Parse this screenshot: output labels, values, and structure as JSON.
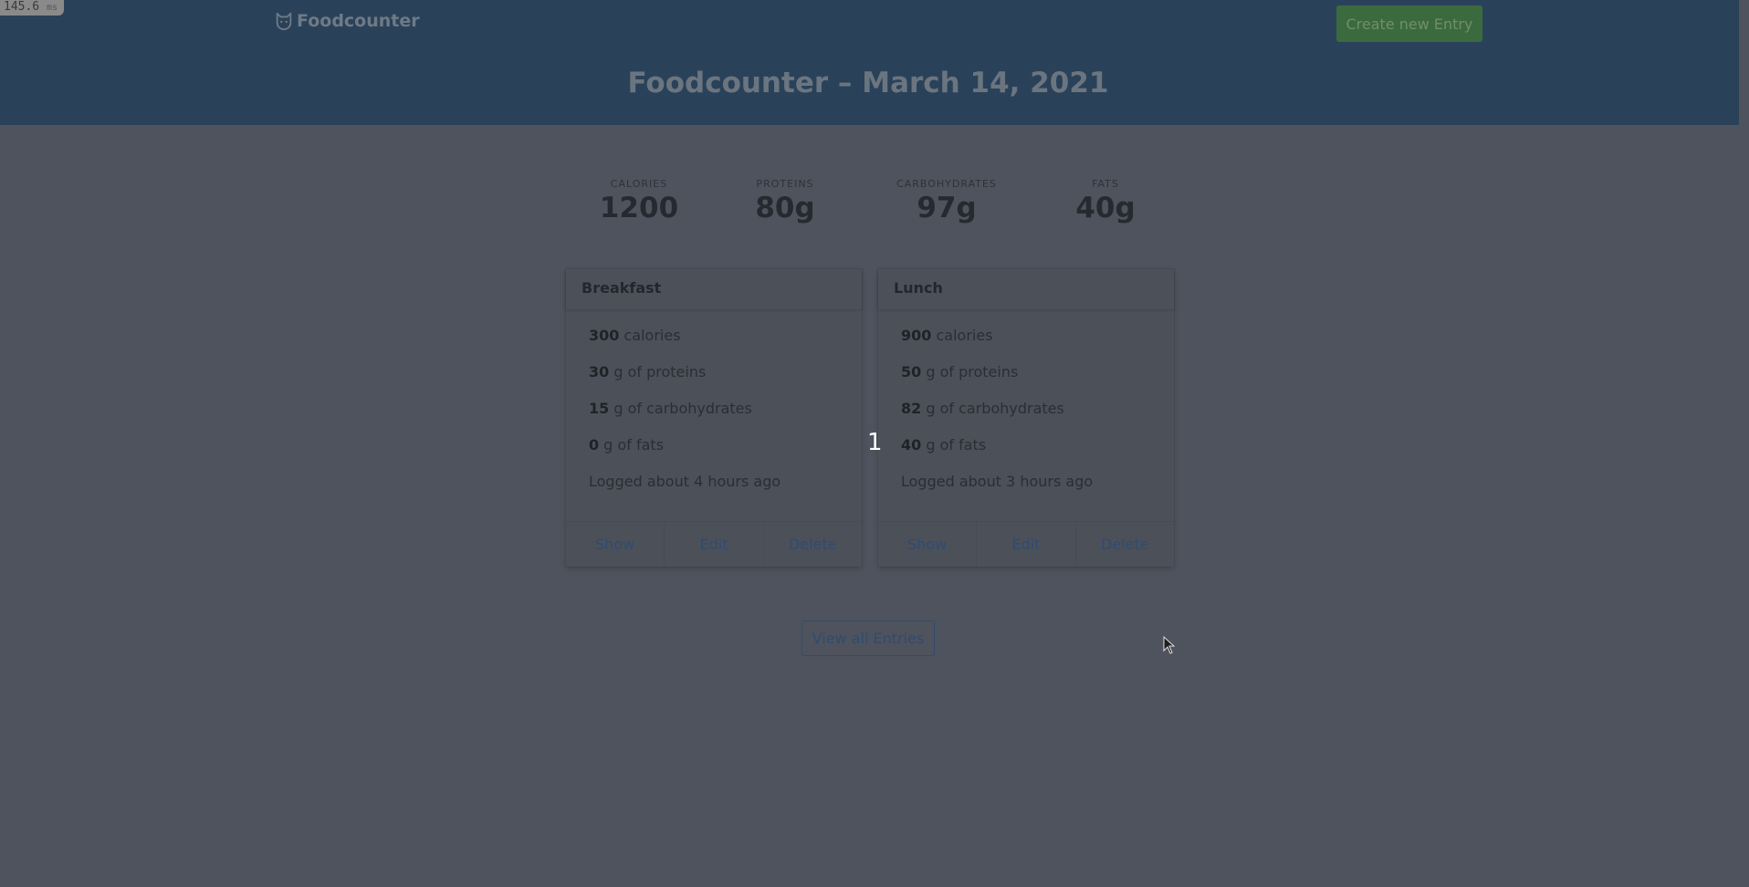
{
  "timing": {
    "value": "145.6",
    "unit": "ms"
  },
  "nav": {
    "brand": "Foodcounter",
    "brand_icon": "cat-face-icon",
    "create_label": "Create new Entry"
  },
  "hero": {
    "title": "Foodcounter – March 14, 2021"
  },
  "stats": [
    {
      "label": "CALORIES",
      "value": "1200"
    },
    {
      "label": "PROTEINS",
      "value": "80g"
    },
    {
      "label": "CARBOHYDRATES",
      "value": "97g"
    },
    {
      "label": "FATS",
      "value": "40g"
    }
  ],
  "cards": [
    {
      "title": "Breakfast",
      "calories": "300",
      "calories_unit": " calories",
      "proteins": "30",
      "proteins_unit": " g of proteins",
      "carbs": "15",
      "carbs_unit": " g of carbohydrates",
      "fats": "0",
      "fats_unit": " g of fats",
      "logged": "Logged about 4 hours ago",
      "show": "Show",
      "edit": "Edit",
      "delete": "Delete"
    },
    {
      "title": "Lunch",
      "calories": "900",
      "calories_unit": " calories",
      "proteins": "50",
      "proteins_unit": " g of proteins",
      "carbs": "82",
      "carbs_unit": " g of carbohydrates",
      "fats": "40",
      "fats_unit": " g of fats",
      "logged": "Logged about 3 hours ago",
      "show": "Show",
      "edit": "Edit",
      "delete": "Delete"
    }
  ],
  "page_number": "1",
  "view_all_label": "View all Entries",
  "colors": {
    "hero": "#2a4259",
    "body": "#4f535d",
    "accent": "#2f4c70",
    "success": "#3b6a3e"
  }
}
